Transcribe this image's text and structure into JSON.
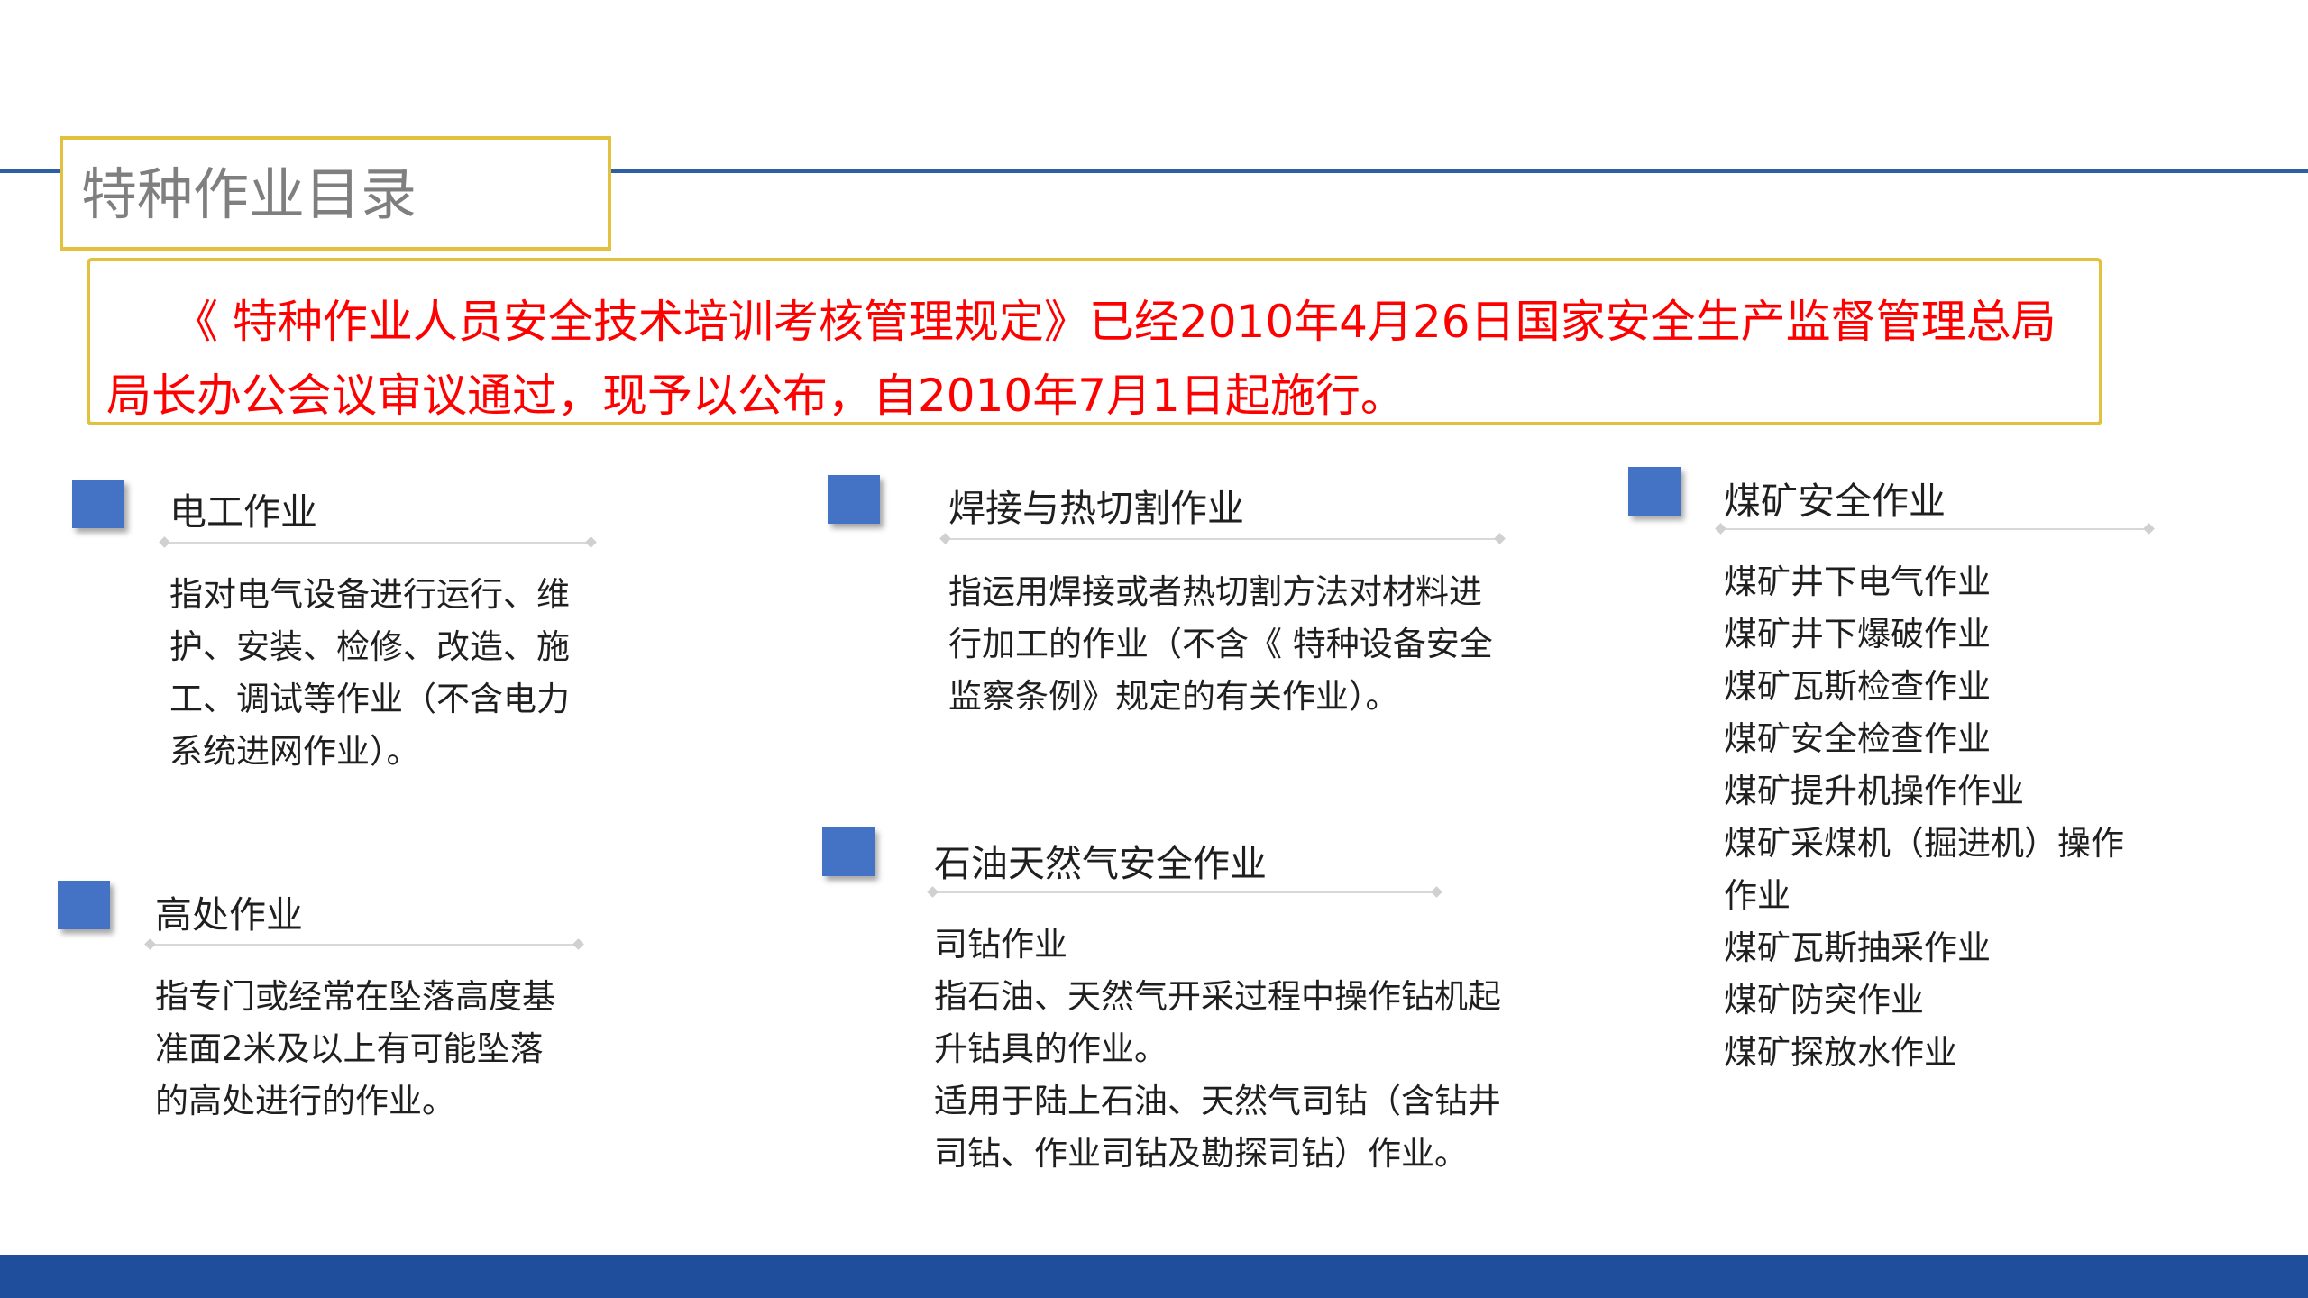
{
  "title": "特种作业目录",
  "notice": "《 特种作业人员安全技术培训考核管理规定》已经2010年4月26日国家安全生产监督管理总局局长办公会议审议通过，现予以公布，自2010年7月1日起施行。",
  "sections": {
    "electrician": {
      "title": "电工作业",
      "description": "指对电气设备进行运行、维护、安装、检修、改造、施工、调试等作业（不含电力系统进网作业）。"
    },
    "height": {
      "title": "高处作业",
      "description": "指专门或经常在坠落高度基准面2米及以上有可能坠落的高处进行的作业。"
    },
    "welding": {
      "title": "焊接与热切割作业",
      "description": "指运用焊接或者热切割方法对材料进行加工的作业（不含《 特种设备安全监察条例》规定的有关作业）。"
    },
    "petroleum": {
      "title": "石油天然气安全作业",
      "lines": [
        "司钻作业",
        "指石油、天然气开采过程中操作钻机起升钻具的作业。",
        "适用于陆上石油、天然气司钻（含钻井司钻、作业司钻及勘探司钻）作业。"
      ]
    },
    "coal": {
      "title": "煤矿安全作业",
      "items": [
        "煤矿井下电气作业",
        "煤矿井下爆破作业",
        "煤矿瓦斯检查作业",
        "煤矿安全检查作业",
        "煤矿提升机操作作业",
        "煤矿采煤机（掘进机）操作作业",
        "煤矿瓦斯抽采作业",
        "煤矿防突作业",
        "煤矿探放水作业"
      ]
    }
  },
  "colors": {
    "accent_blue": "#2e5fa5",
    "marker_blue": "#4472c4",
    "bottom_bar": "#1e4e9c",
    "frame_gold": "#e2c13e",
    "notice_red": "#ff0000"
  }
}
